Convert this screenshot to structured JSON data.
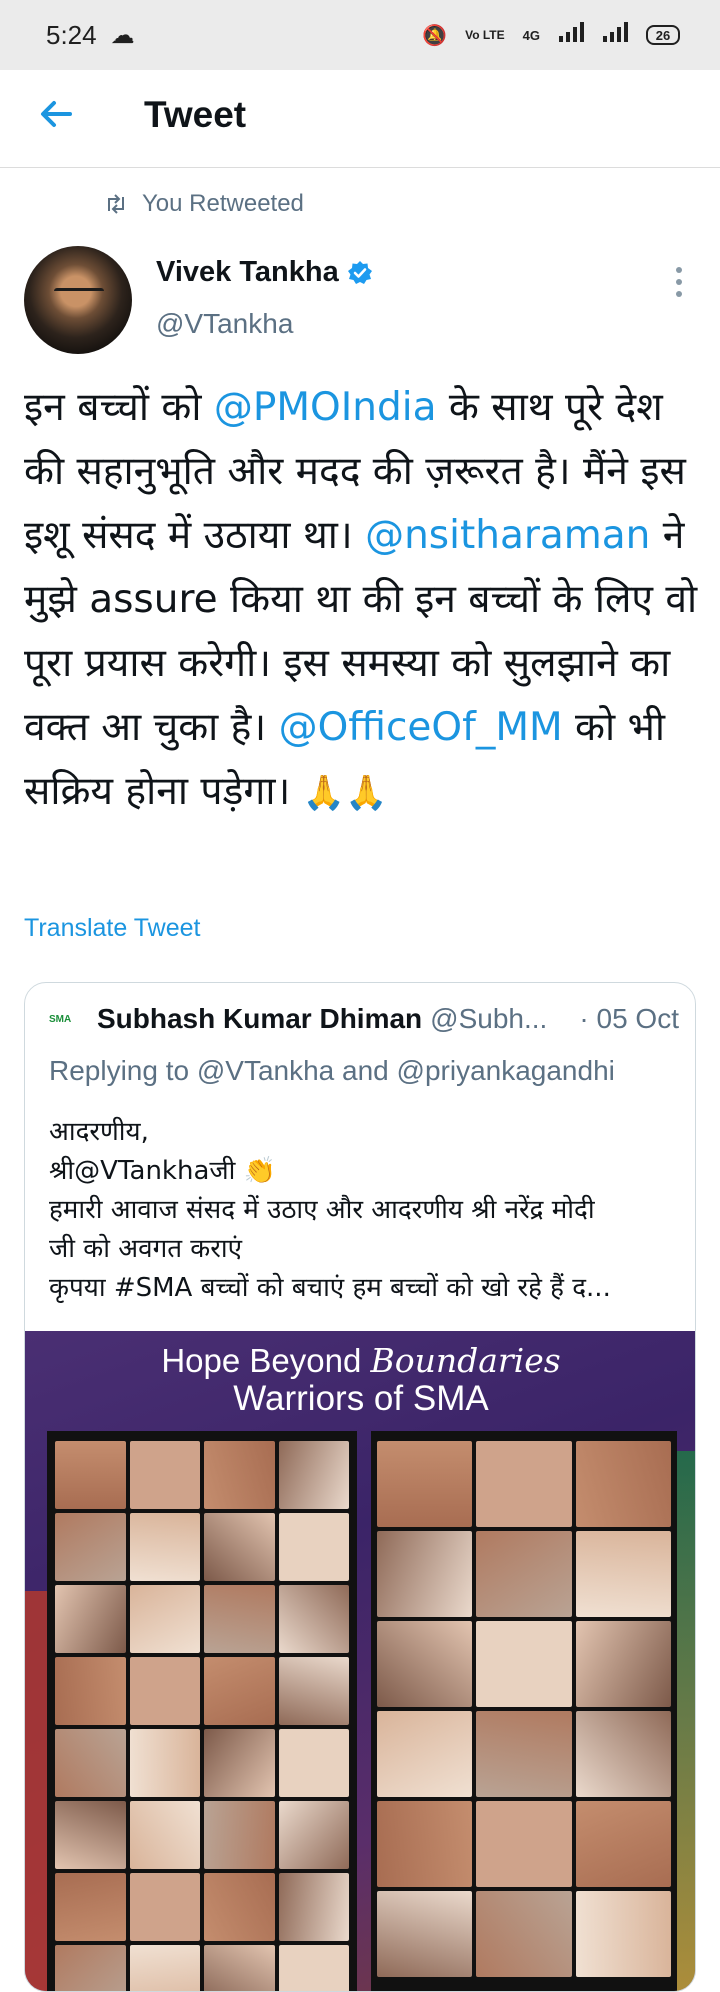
{
  "status_bar": {
    "time": "5:24",
    "cloud_icon": "cloud-icon",
    "volte": "Vo LTE",
    "network": "4G",
    "battery": "26"
  },
  "app_bar": {
    "title": "Tweet",
    "back_icon": "arrow-left-icon"
  },
  "retweet": {
    "label": "You Retweeted",
    "icon": "retweet-icon"
  },
  "tweet": {
    "author_name": "Vivek Tankha",
    "verified_icon": "verified-badge-icon",
    "handle": "@VTankha",
    "text_parts": {
      "p1": "इन बच्चों को ",
      "m1": "@PMOIndia",
      "p2": " के साथ पूरे देश की सहानुभूति और मदद की ज़रूरत है। मैंने इस इशू संसद में उठाया था। ",
      "m2": "@nsitharaman",
      "p3": " ने मुझे assure किया था की इन बच्चों के लिए वो पूरा प्रयास करेगी। इस समस्या को सुलझाने का वक्त आ चुका है। ",
      "m3": "@OfficeOf_MM",
      "p4": " को भी सक्रिय होना पड़ेगा। ",
      "emoji": "🙏🙏"
    },
    "translate_label": "Translate Tweet"
  },
  "quoted_tweet": {
    "logo_text": "SMA",
    "author_name": "Subhash Kumar Dhiman",
    "handle": "@Subh...",
    "date": "· 05 Oct",
    "replying_to": "Replying to @VTankha and @priyankagandhi",
    "lines": [
      "आदरणीय,",
      "श्री@VTankhaजी 👏",
      "हमारी आवाज संसद में उठाए और आदरणीय श्री नरेंद्र मोदी",
      "जी को अवगत कराएं",
      "कृपया #SMA बच्चों को बचाएं हम बच्चों को खो रहे हैं द..."
    ],
    "media": {
      "title_line1_a": "Hope Beyond ",
      "title_line1_b": "Boundaries",
      "title_line2": "Warriors of SMA"
    }
  },
  "colors": {
    "accent": "#1b95e0",
    "secondary_text": "#5b7083",
    "status_bar_bg": "#ebebeb",
    "verified": "#1d9bf0"
  }
}
